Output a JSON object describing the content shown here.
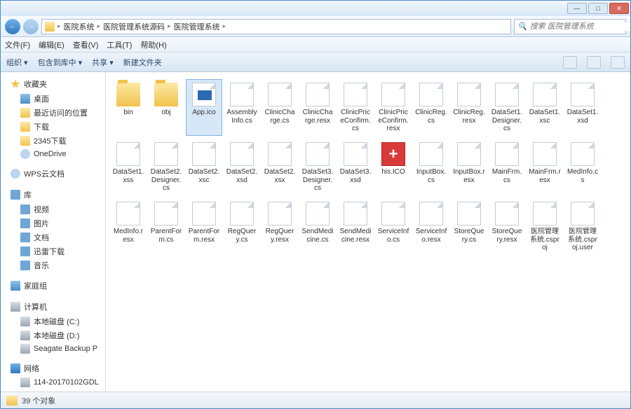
{
  "titlebar": {
    "min": "—",
    "max": "□",
    "close": "✕"
  },
  "nav": {
    "crumbs": [
      "医院系统",
      "医院管理系统源码",
      "医院管理系统"
    ],
    "search_placeholder": "搜索 医院管理系统"
  },
  "menu": {
    "file": "文件(F)",
    "edit": "编辑(E)",
    "view": "查看(V)",
    "tools": "工具(T)",
    "help": "帮助(H)"
  },
  "toolbar": {
    "organize": "组织 ▾",
    "include": "包含到库中 ▾",
    "share": "共享 ▾",
    "newfolder": "新建文件夹"
  },
  "sidebar": {
    "fav": {
      "hdr": "收藏夹",
      "items": [
        "桌面",
        "最近访问的位置",
        "下载",
        "2345下载",
        "OneDrive"
      ]
    },
    "wps": "WPS云文档",
    "lib": {
      "hdr": "库",
      "items": [
        "视频",
        "图片",
        "文档",
        "迅雷下载",
        "音乐"
      ]
    },
    "home": "家庭组",
    "pc": {
      "hdr": "计算机",
      "items": [
        "本地磁盘 (C:)",
        "本地磁盘 (D:)",
        "Seagate Backup P"
      ]
    },
    "net": {
      "hdr": "网络",
      "items": [
        "114-20170102GDL"
      ]
    }
  },
  "files": [
    {
      "name": "bin",
      "type": "folder"
    },
    {
      "name": "obj",
      "type": "folder"
    },
    {
      "name": "App.ico",
      "type": "ico-blue",
      "selected": true
    },
    {
      "name": "AssemblyInfo.cs",
      "type": "file"
    },
    {
      "name": "ClinicCharge.cs",
      "type": "file"
    },
    {
      "name": "ClinicCharge.resx",
      "type": "file"
    },
    {
      "name": "ClinicPriceConfirm.cs",
      "type": "file"
    },
    {
      "name": "ClinicPriceConfirm.resx",
      "type": "file"
    },
    {
      "name": "ClinicReg.cs",
      "type": "file"
    },
    {
      "name": "ClinicReg.resx",
      "type": "file"
    },
    {
      "name": "DataSet1.Designer.cs",
      "type": "file"
    },
    {
      "name": "DataSet1.xsc",
      "type": "file"
    },
    {
      "name": "DataSet1.xsd",
      "type": "file"
    },
    {
      "name": "DataSet1.xss",
      "type": "file"
    },
    {
      "name": "DataSet2.Designer.cs",
      "type": "file"
    },
    {
      "name": "DataSet2.xsc",
      "type": "file"
    },
    {
      "name": "DataSet2.xsd",
      "type": "file"
    },
    {
      "name": "DataSet2.xsx",
      "type": "file"
    },
    {
      "name": "DataSet3.Designer.cs",
      "type": "file"
    },
    {
      "name": "DataSet3.xsd",
      "type": "file"
    },
    {
      "name": "his.ICO",
      "type": "ico-red"
    },
    {
      "name": "InputBox.cs",
      "type": "file"
    },
    {
      "name": "InputBox.resx",
      "type": "file"
    },
    {
      "name": "MainFrm.cs",
      "type": "file"
    },
    {
      "name": "MainFrm.resx",
      "type": "file"
    },
    {
      "name": "MedInfo.cs",
      "type": "file"
    },
    {
      "name": "MedInfo.resx",
      "type": "file"
    },
    {
      "name": "ParentForm.cs",
      "type": "file"
    },
    {
      "name": "ParentForm.resx",
      "type": "file"
    },
    {
      "name": "RegQuery.cs",
      "type": "file"
    },
    {
      "name": "RegQuery.resx",
      "type": "file"
    },
    {
      "name": "SendMedicine.cs",
      "type": "file"
    },
    {
      "name": "SendMedicine.resx",
      "type": "file"
    },
    {
      "name": "ServiceInfo.cs",
      "type": "file"
    },
    {
      "name": "ServiceInfo.resx",
      "type": "file"
    },
    {
      "name": "StoreQuery.cs",
      "type": "file"
    },
    {
      "name": "StoreQuery.resx",
      "type": "file"
    },
    {
      "name": "医院管理系统.csproj",
      "type": "file"
    },
    {
      "name": "医院管理系统.csproj.user",
      "type": "file"
    }
  ],
  "status": {
    "text": "39 个对象"
  }
}
